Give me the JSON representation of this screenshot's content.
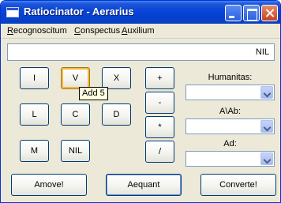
{
  "window": {
    "title": "Ratiocinator - Aerarius"
  },
  "menu": [
    {
      "accel": "R",
      "rest": "ecognoscitum"
    },
    {
      "accel": "C",
      "rest": "onspectus"
    },
    {
      "accel": "A",
      "rest": "uxilium"
    }
  ],
  "display": {
    "value": "NIL"
  },
  "numerals": [
    "I",
    "V",
    "X",
    "L",
    "C",
    "D",
    "M",
    "NIL"
  ],
  "operators": [
    "+",
    "-",
    "*",
    "/"
  ],
  "tooltip": {
    "text": "Add 5"
  },
  "selectors": {
    "humanitas_label": "Humanitas:",
    "humanitas_value": "",
    "from_label": "A\\Ab:",
    "from_value": "",
    "to_label": "Ad:",
    "to_value": ""
  },
  "actions": {
    "clear": "Amove!",
    "equals": "Aequant",
    "convert": "Converte!"
  },
  "colors": {
    "titlebar": "#0a46d8",
    "window_bg": "#ece9d8",
    "button_border": "#003c74",
    "hover_highlight": "#f8b636",
    "tooltip_bg": "#ffffe1"
  },
  "icons": {
    "app": "calculator-window-icon",
    "minimize": "minimize-icon",
    "maximize": "maximize-icon",
    "close": "close-icon",
    "dropdown": "chevron-down-icon"
  }
}
